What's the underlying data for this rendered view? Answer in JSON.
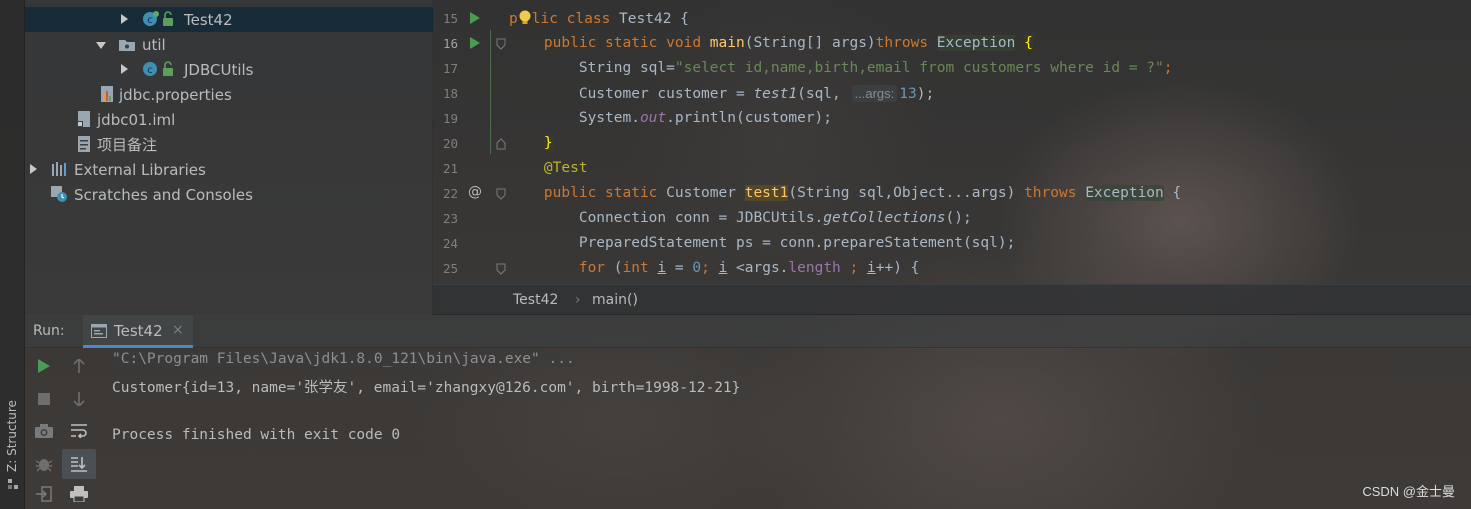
{
  "project_tree": {
    "items": [
      {
        "label": "Test42",
        "type": "class-file"
      },
      {
        "label": "util",
        "type": "package"
      },
      {
        "label": "JDBCUtils",
        "type": "class-file"
      },
      {
        "label": "jdbc.properties",
        "type": "properties-file"
      },
      {
        "label": "jdbc01.iml",
        "type": "iml-file"
      },
      {
        "label": "项目备注",
        "type": "text-file"
      },
      {
        "label": "External Libraries",
        "type": "libraries"
      },
      {
        "label": "Scratches and Consoles",
        "type": "scratches"
      }
    ]
  },
  "editor": {
    "line_numbers": [
      "15",
      "16",
      "17",
      "18",
      "19",
      "20",
      "21",
      "22",
      "23",
      "24",
      "25"
    ],
    "lines": {
      "l15": {
        "a": "p",
        "b": "lic ",
        "c": "class ",
        "d": "Test42 {"
      },
      "l16": {
        "a": "public static void ",
        "b": "main",
        "c": "(String[] args)",
        "d": "throws ",
        "e": "Exception",
        "f": " ",
        "g": "{"
      },
      "l17": {
        "a": "String sql=",
        "b": "\"select id,name,birth,email from customers where id = ?\"",
        "c": ";"
      },
      "l18": {
        "a": "Customer customer = ",
        "b": "test1",
        "c": "(sql, ",
        "hint": "...args:",
        "d": "13",
        "e": ");"
      },
      "l19": {
        "a": "System.",
        "b": "out",
        "c": ".println(customer);"
      },
      "l20": {
        "a": "}"
      },
      "l21": {
        "a": "@Test"
      },
      "l22": {
        "a": "public static ",
        "b": "Customer ",
        "c": "test1",
        "d": "(String sql,Object...args) ",
        "e": "throws ",
        "f": "Exception",
        "g": " {"
      },
      "l23": {
        "a": "Connection conn = JDBCUtils.",
        "b": "getCollections",
        "c": "();"
      },
      "l24": {
        "a": "PreparedStatement ps = conn.prepareStatement(sql);"
      },
      "l25": {
        "a": "for ",
        "b": "(",
        "c": "int ",
        "d": "i",
        "e": " = ",
        "f": "0",
        "g": "; ",
        "h": "i",
        "i": " <args.",
        "j": "length",
        "k": " ; ",
        "l": "i",
        "m": "++) {"
      }
    }
  },
  "breadcrumb": {
    "file": "Test42",
    "separator": "›",
    "method": "main()"
  },
  "run_panel": {
    "label": "Run:",
    "tab_label": "Test42",
    "tab_close": "×",
    "console_lines": [
      "\"C:\\Program Files\\Java\\jdk1.8.0_121\\bin\\java.exe\" ...",
      "Customer{id=13, name='张学友', email='zhangxy@126.com', birth=1998-12-21}",
      "",
      "Process finished with exit code 0"
    ]
  },
  "side_strip": {
    "structure_label": "Z: Structure"
  },
  "watermark": "CSDN @金士曼",
  "colors": {
    "keyword": "#cc7832",
    "string": "#6a8759",
    "method": "#ffc66d",
    "number": "#6897bb",
    "annotation": "#bbb529",
    "run_green": "#499c54",
    "selection": "#0d293e"
  }
}
